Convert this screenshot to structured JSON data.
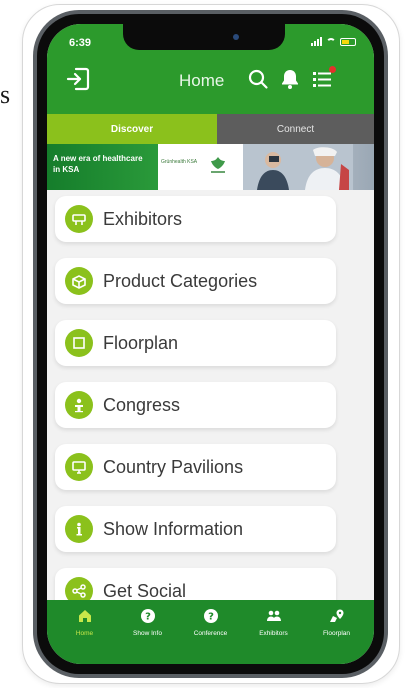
{
  "stray_text": "s",
  "status_bar": {
    "time": "6:39"
  },
  "header": {
    "title": "Home"
  },
  "tabs": [
    {
      "label": "Discover",
      "active": true
    },
    {
      "label": "Connect",
      "active": false
    }
  ],
  "banner": {
    "text": "A new era of healthcare in KSA",
    "logo_text": "Grünhealth KSA"
  },
  "menu": [
    {
      "label": "Exhibitors",
      "icon": "exhibitor-booth-icon"
    },
    {
      "label": "Product Categories",
      "icon": "box-icon"
    },
    {
      "label": "Floorplan",
      "icon": "square-icon"
    },
    {
      "label": "Congress",
      "icon": "podium-icon"
    },
    {
      "label": "Country Pavilions",
      "icon": "monitor-icon"
    },
    {
      "label": "Show Information",
      "icon": "info-icon"
    },
    {
      "label": "Get Social",
      "icon": "share-icon"
    }
  ],
  "bottom_nav": [
    {
      "label": "Home",
      "active": true
    },
    {
      "label": "Show Info",
      "active": false
    },
    {
      "label": "Conference",
      "active": false
    },
    {
      "label": "Exhibitors",
      "active": false
    },
    {
      "label": "Floorplan",
      "active": false
    }
  ],
  "colors": {
    "header_green": "#2c9a2c",
    "accent_lime": "#8bc11c",
    "connect_gray": "#5d5d5d",
    "nav_green": "#1f8a2a"
  }
}
